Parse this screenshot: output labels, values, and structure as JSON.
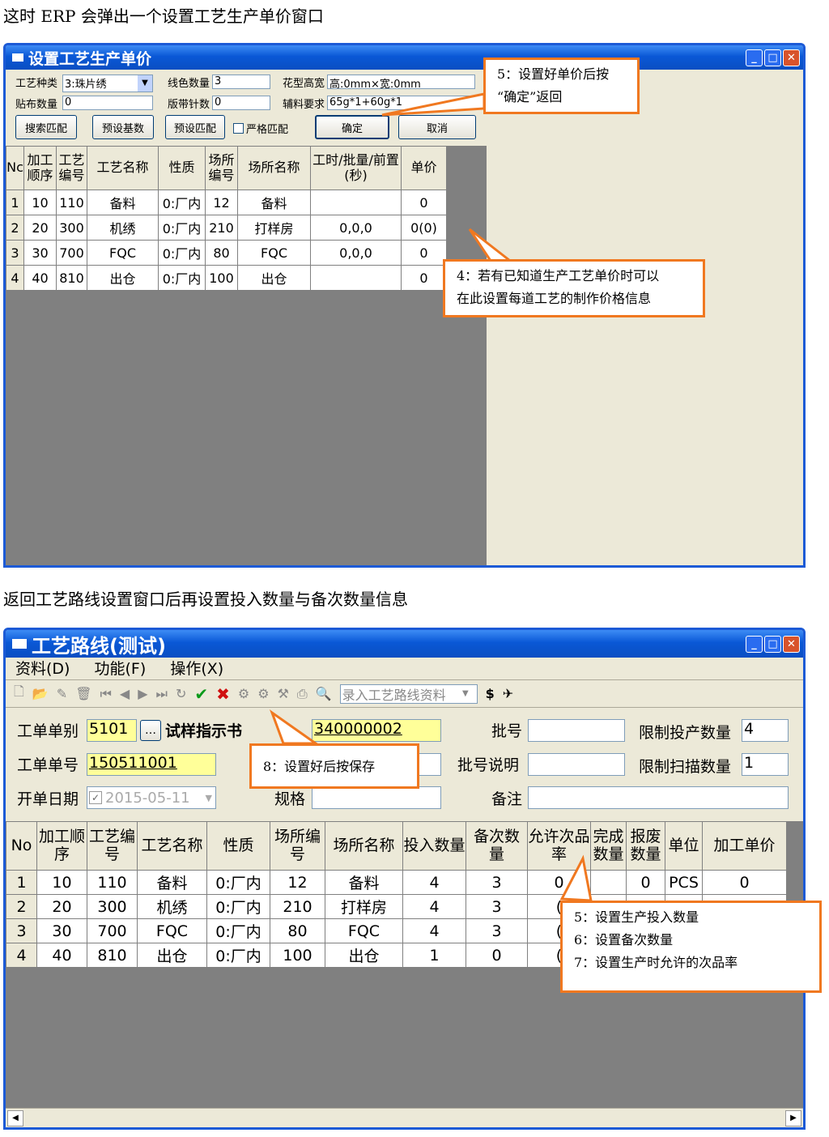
{
  "captions": {
    "top": "这时 ERP 会弹出一个设置工艺生产单价窗口",
    "middle": "返回工艺路线设置窗口后再设置投入数量与备次数量信息"
  },
  "win1": {
    "title": "设置工艺生产单价",
    "fields": {
      "process_type_label": "工艺种类",
      "process_type_value": "3:珠片绣",
      "thread_count_label": "线色数量",
      "thread_count_value": "3",
      "pattern_size_label": "花型高宽",
      "pattern_size_value": "高:0mm×宽:0mm",
      "patch_qty_label": "贴布数量",
      "patch_qty_value": "0",
      "plate_stitch_label": "版带针数",
      "plate_stitch_value": "0",
      "material_req_label": "辅料要求",
      "material_req_value": "65g*1+60g*1"
    },
    "buttons": {
      "search_match": "搜索匹配",
      "preset_base": "预设基数",
      "preset_match": "预设匹配",
      "strict_match": "严格匹配",
      "ok": "确定",
      "cancel": "取消"
    },
    "table": {
      "headers": [
        "Nc",
        "加工顺序",
        "工艺编号",
        "工艺名称",
        "性质",
        "场所编号",
        "场所名称",
        "工时/批量/前置(秒)",
        "单价"
      ],
      "rows": [
        [
          "1",
          "10",
          "110",
          "备料",
          "0:厂内",
          "12",
          "备料",
          "",
          "0"
        ],
        [
          "2",
          "20",
          "300",
          "机绣",
          "0:厂内",
          "210",
          "打样房",
          "0,0,0",
          "0(0)"
        ],
        [
          "3",
          "30",
          "700",
          "FQC",
          "0:厂内",
          "80",
          "FQC",
          "0,0,0",
          "0"
        ],
        [
          "4",
          "40",
          "810",
          "出仓",
          "0:厂内",
          "100",
          "出仓",
          "",
          "0"
        ]
      ]
    },
    "callout_confirm": [
      "5：设置好单价后按",
      "“确定”返回"
    ],
    "callout_price": [
      "4：若有已知道生产工艺单价时可以",
      "在此设置每道工艺的制作价格信息"
    ]
  },
  "win2": {
    "title": "工艺路线(测试)",
    "menu": [
      "资料(D)",
      "功能(F)",
      "操作(X)"
    ],
    "toolbar_combo": "录入工艺路线资料",
    "form": {
      "order_type_label": "工单单别",
      "order_type_value": "5101",
      "order_type_name": "试样指示书",
      "order_no_label": "工单单号",
      "order_no_value": "150511001",
      "open_date_label": "开单日期",
      "open_date_value": "2015-05-11",
      "item_value": "340000002",
      "spec_label": "规格",
      "batch_label": "批号",
      "batch_desc_label": "批号说明",
      "remark_label": "备注",
      "limit_input_label": "限制投产数量",
      "limit_input_value": "4",
      "limit_scan_label": "限制扫描数量",
      "limit_scan_value": "1"
    },
    "table": {
      "headers": [
        "No",
        "加工顺序",
        "工艺编号",
        "工艺名称",
        "性质",
        "场所编号",
        "场所名称",
        "投入数量",
        "备次数量",
        "允许次品率",
        "完成数量",
        "报废数量",
        "单位",
        "加工单价"
      ],
      "rows": [
        [
          "1",
          "10",
          "110",
          "备料",
          "0:厂内",
          "12",
          "备料",
          "4",
          "3",
          "0",
          "",
          "0",
          "PCS",
          "0"
        ],
        [
          "2",
          "20",
          "300",
          "机绣",
          "0:厂内",
          "210",
          "打样房",
          "4",
          "3",
          "(",
          "",
          "",
          "",
          ""
        ],
        [
          "3",
          "30",
          "700",
          "FQC",
          "0:厂内",
          "80",
          "FQC",
          "4",
          "3",
          "(",
          "",
          "",
          "",
          ""
        ],
        [
          "4",
          "40",
          "810",
          "出仓",
          "0:厂内",
          "100",
          "出仓",
          "1",
          "0",
          "(",
          "",
          "",
          "",
          ""
        ]
      ]
    },
    "callout_save": "8：设置好后按保存",
    "callout_qty": [
      "5：设置生产投入数量",
      "6：设置备次数量",
      "7：设置生产时允许的次品率"
    ]
  }
}
